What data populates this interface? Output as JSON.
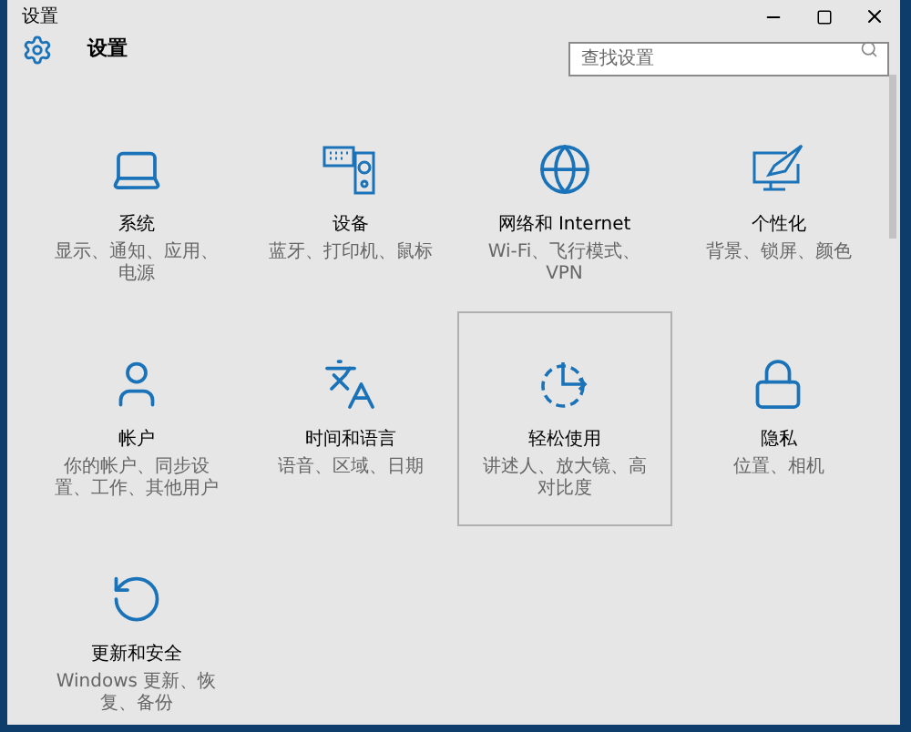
{
  "window": {
    "title": "设置"
  },
  "header": {
    "title": "设置"
  },
  "search": {
    "placeholder": "查找设置"
  },
  "tiles": [
    {
      "kind": "system",
      "title": "系统",
      "description": "显示、通知、应用、电源",
      "selected": false
    },
    {
      "kind": "devices",
      "title": "设备",
      "description": "蓝牙、打印机、鼠标",
      "selected": false
    },
    {
      "kind": "network",
      "title": "网络和 Internet",
      "description": "Wi-Fi、飞行模式、VPN",
      "selected": false
    },
    {
      "kind": "personalization",
      "title": "个性化",
      "description": "背景、锁屏、颜色",
      "selected": false
    },
    {
      "kind": "accounts",
      "title": "帐户",
      "description": "你的帐户、同步设置、工作、其他用户",
      "selected": false
    },
    {
      "kind": "time",
      "title": "时间和语言",
      "description": "语音、区域、日期",
      "selected": false
    },
    {
      "kind": "ease",
      "title": "轻松使用",
      "description": "讲述人、放大镜、高对比度",
      "selected": true
    },
    {
      "kind": "privacy",
      "title": "隐私",
      "description": "位置、相机",
      "selected": false
    },
    {
      "kind": "update",
      "title": "更新和安全",
      "description": "Windows 更新、恢复、备份",
      "selected": false
    }
  ]
}
